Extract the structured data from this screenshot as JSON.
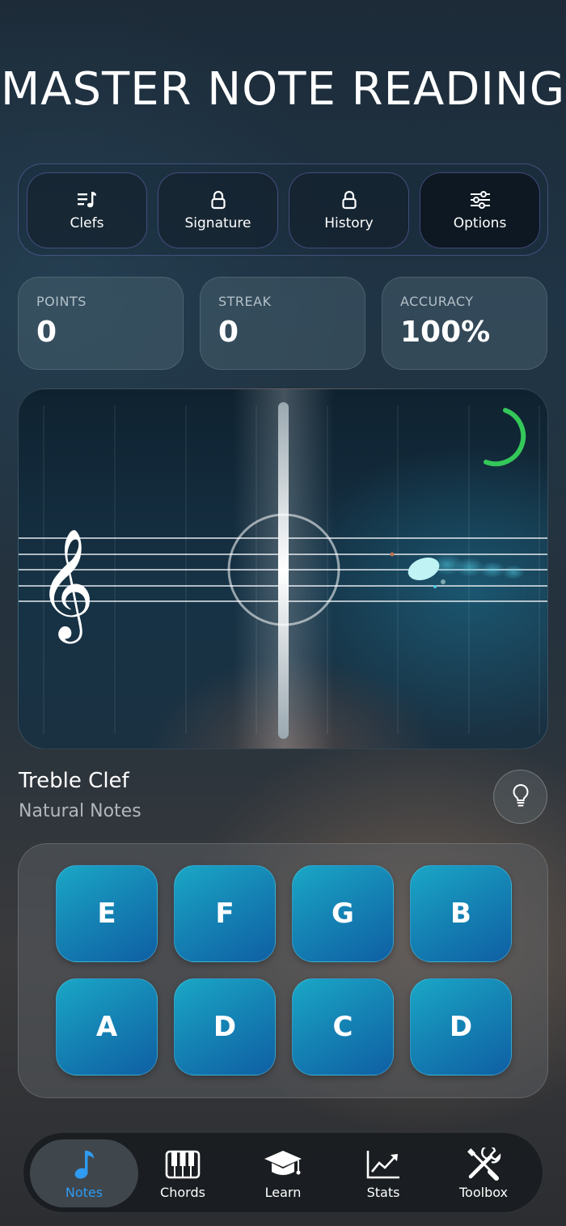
{
  "title": "MASTER NOTE READING",
  "options": [
    {
      "label": "Clefs",
      "icon": "clef-list-icon",
      "locked": false
    },
    {
      "label": "Signature",
      "icon": "lock-icon",
      "locked": true
    },
    {
      "label": "History",
      "icon": "lock-icon",
      "locked": true
    },
    {
      "label": "Options",
      "icon": "sliders-icon",
      "locked": false
    }
  ],
  "stats": [
    {
      "label": "POINTS",
      "value": "0"
    },
    {
      "label": "STREAK",
      "value": "0"
    },
    {
      "label": "ACCURACY",
      "value": "100%"
    }
  ],
  "staff": {
    "clef_icon": "treble-clef-icon",
    "timer_color": "#34c759",
    "note_color": "#bff3f4"
  },
  "clef_info": {
    "name": "Treble Clef",
    "subtitle": "Natural Notes"
  },
  "answer_keys": [
    "E",
    "F",
    "G",
    "B",
    "A",
    "D",
    "C",
    "D"
  ],
  "tabs": [
    {
      "label": "Notes",
      "icon": "music-note-icon",
      "active": true
    },
    {
      "label": "Chords",
      "icon": "piano-icon",
      "active": false
    },
    {
      "label": "Learn",
      "icon": "graduation-cap-icon",
      "active": false
    },
    {
      "label": "Stats",
      "icon": "chart-icon",
      "active": false
    },
    {
      "label": "Toolbox",
      "icon": "tools-icon",
      "active": false
    }
  ],
  "colors": {
    "accent": "#2f9bf2",
    "key_gradient": [
      "#1aa7c6",
      "#0f5fa3"
    ]
  }
}
